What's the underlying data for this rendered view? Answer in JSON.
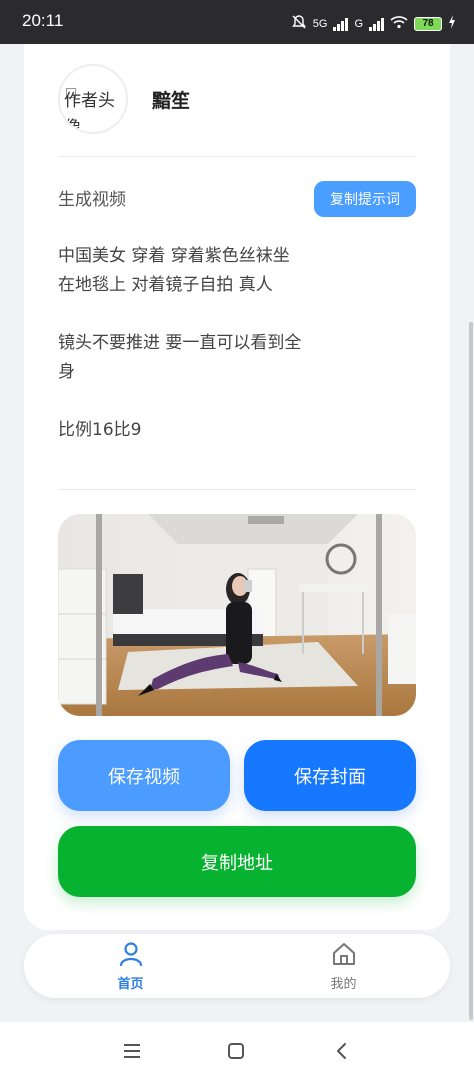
{
  "status_bar": {
    "time": "20:11",
    "network_label_1": "5G",
    "network_label_2": "G",
    "battery": "78",
    "icons": [
      "bell-muted-icon",
      "signal-icon",
      "signal-icon",
      "wifi-icon",
      "battery-icon",
      "charging-icon"
    ]
  },
  "author": {
    "avatar_alt": "作者头像",
    "name": "黯笙"
  },
  "prompt": {
    "title": "生成视频",
    "copy_button": "复制提示词",
    "text": "中国美女 穿着 穿着紫色丝袜坐在地毯上 对着镜子自拍 真人\n\n镜头不要推进 要一直可以看到全身\n\n比例16比9"
  },
  "actions": {
    "save_video": "保存视频",
    "save_cover": "保存封面",
    "copy_url": "复制地址"
  },
  "tabbar": {
    "home": "首页",
    "mine": "我的"
  },
  "colors": {
    "primary_blue": "#4c9bff",
    "deep_blue": "#1677ff",
    "green": "#07b230",
    "active_tab": "#2f7fe0"
  }
}
